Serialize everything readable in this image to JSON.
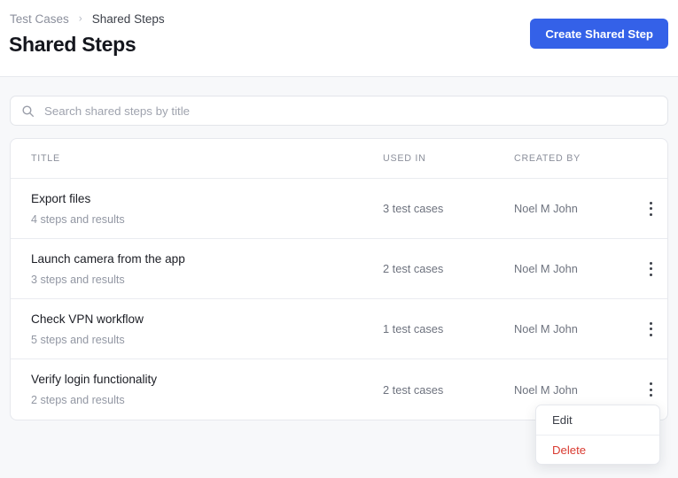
{
  "header": {
    "breadcrumb": {
      "root": "Test Cases",
      "separator": "›",
      "current": "Shared Steps"
    },
    "title": "Shared Steps",
    "create_button": "Create Shared Step"
  },
  "search": {
    "placeholder": "Search shared steps by title",
    "value": "",
    "icon": "search-icon"
  },
  "table": {
    "columns": [
      "TITLE",
      "USED IN",
      "CREATED BY"
    ],
    "rows": [
      {
        "title": "Export files",
        "subtitle": "4 steps and results",
        "used_in": "3 test cases",
        "created_by": "Noel M John",
        "action_icon": "kebab-menu-icon"
      },
      {
        "title": "Launch camera from the app",
        "subtitle": "3 steps and results",
        "used_in": "2 test cases",
        "created_by": "Noel M John",
        "action_icon": "kebab-menu-icon"
      },
      {
        "title": "Check VPN workflow",
        "subtitle": "5 steps and results",
        "used_in": "1 test cases",
        "created_by": "Noel M John",
        "action_icon": "kebab-menu-icon"
      },
      {
        "title": "Verify login functionality",
        "subtitle": "2 steps and results",
        "used_in": "2 test cases",
        "created_by": "Noel M John",
        "action_icon": "kebab-menu-icon"
      }
    ]
  },
  "context_menu": {
    "items": [
      {
        "label": "Edit",
        "kind": "default"
      },
      {
        "label": "Delete",
        "kind": "danger"
      }
    ]
  },
  "colors": {
    "accent": "#3461e8",
    "danger": "#d93b31",
    "page_background": "#f7f8fa",
    "surface": "#ffffff",
    "border": "#e6e8ed",
    "text_primary": "#18191f",
    "text_muted": "#8c909c"
  }
}
